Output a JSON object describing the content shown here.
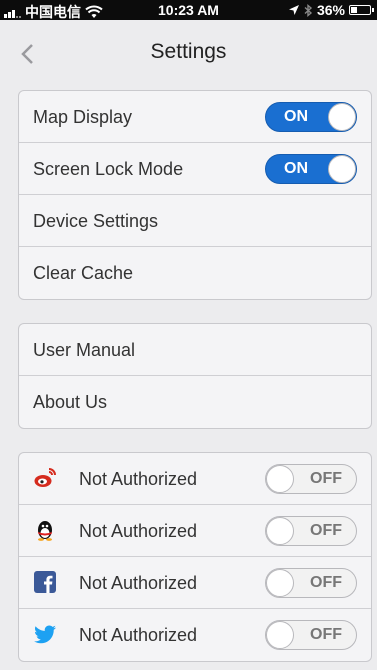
{
  "status_bar": {
    "carrier": "中国电信",
    "time": "10:23 AM",
    "battery": "36%",
    "battery_level": 0.36
  },
  "nav": {
    "title": "Settings"
  },
  "display_group": {
    "items": [
      {
        "label": "Map Display",
        "toggle": "ON"
      },
      {
        "label": "Screen Lock Mode",
        "toggle": "ON"
      },
      {
        "label": "Device Settings"
      },
      {
        "label": "Clear Cache"
      }
    ]
  },
  "info_group": {
    "items": [
      {
        "label": "User Manual"
      },
      {
        "label": "About Us"
      }
    ]
  },
  "social_group": {
    "items": [
      {
        "icon": "weibo-icon",
        "label": "Not Authorized",
        "toggle": "OFF"
      },
      {
        "icon": "qq-icon",
        "label": "Not Authorized",
        "toggle": "OFF"
      },
      {
        "icon": "facebook-icon",
        "label": "Not Authorized",
        "toggle": "OFF"
      },
      {
        "icon": "twitter-icon",
        "label": "Not Authorized",
        "toggle": "OFF"
      }
    ]
  },
  "colors": {
    "toggle_on": "#1a6fd1",
    "background": "#ececee",
    "weibo": "#d52b1e",
    "facebook": "#3b5998",
    "twitter": "#1da1f2"
  }
}
